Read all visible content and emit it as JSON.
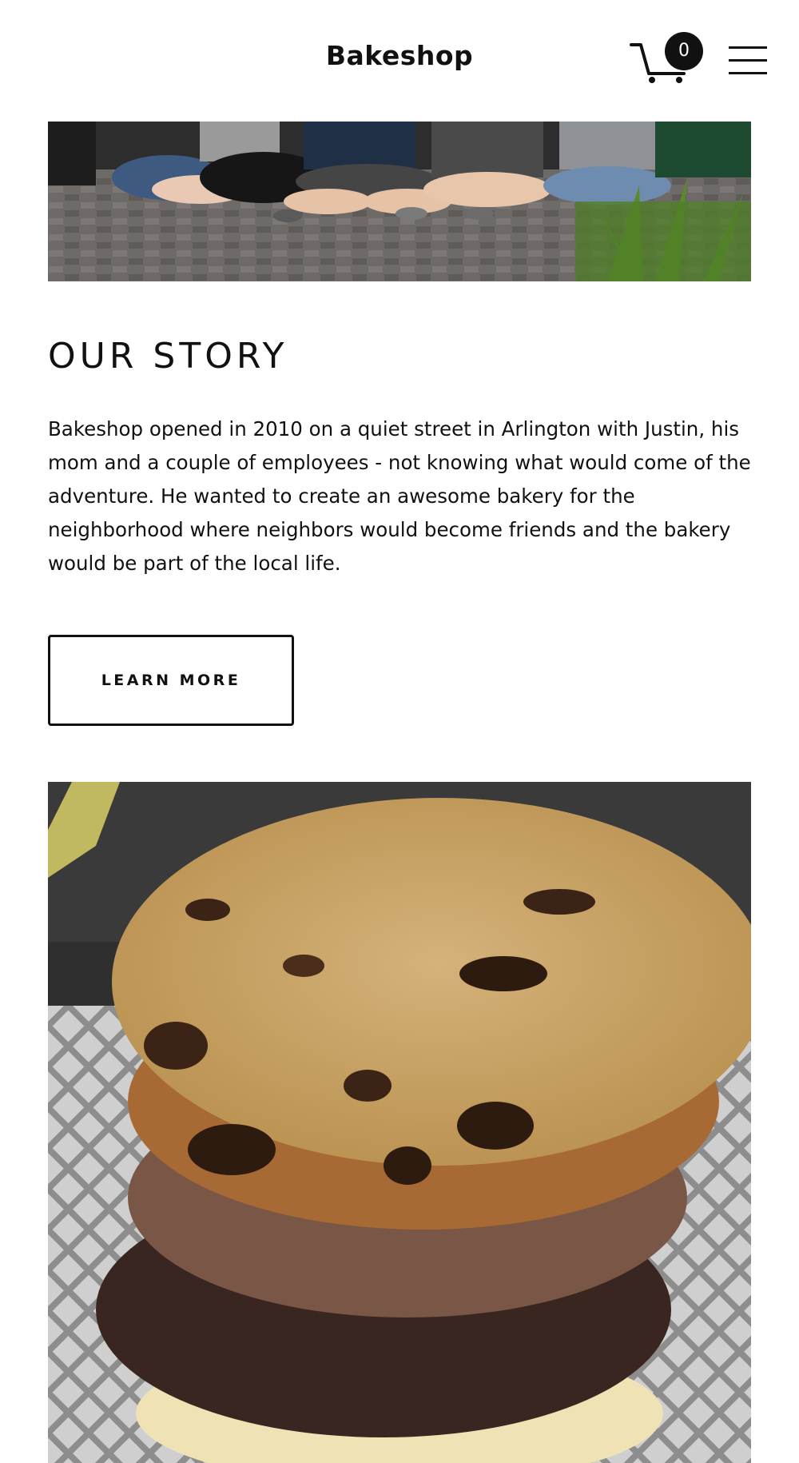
{
  "header": {
    "logo_text": "Bakeshop",
    "cart_count": "0",
    "cart_icon": "shopping-cart-icon",
    "menu_icon": "hamburger-menu-icon"
  },
  "images": {
    "team_photo": "group of people sitting cross-legged on brick pavement wearing Bakeshop t-shirts",
    "cookie_photo": "stack of cookies: chocolate chip on top, ginger molasses, brownie cookie, dark chocolate, sugar cookie"
  },
  "story": {
    "title": "OUR STORY",
    "body": "Bakeshop opened in 2010 on a quiet street in Arlington with Justin, his mom and a couple of employees - not knowing what would come of the adventure.  He wanted to create an awesome bakery for the neighborhood where neighbors would become friends and the bakery would be part of the local life.",
    "button_label": "LEARN MORE"
  },
  "colors": {
    "text": "#111111",
    "background": "#ffffff",
    "badge": "#111111"
  }
}
